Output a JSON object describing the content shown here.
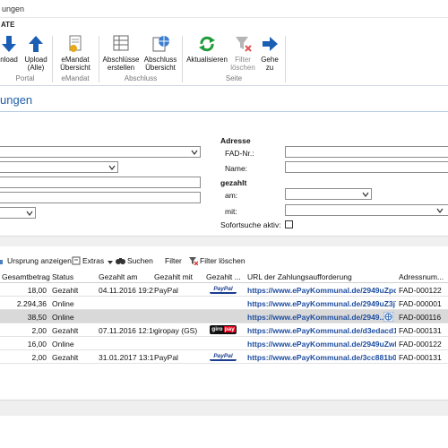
{
  "window": {
    "title": "ungen"
  },
  "ribbon": {
    "tab_label": "ATE",
    "buttons": {
      "download": "nload",
      "upload": "Upload (Alle)",
      "emandat": "eMandat Übersicht",
      "abschluesse_erstellen": "Abschlüsse erstellen",
      "abschluss_uebersicht": "Abschluss Übersicht",
      "aktualisieren": "Aktualisieren",
      "filter_loeschen": "Filter löschen",
      "gehe_zu": "Gehe zu"
    },
    "groups": {
      "portal": "Portal",
      "emandat": "eMandat",
      "abschluss": "Abschluss",
      "seite": "Seite"
    }
  },
  "page": {
    "heading": "ungen"
  },
  "filters": {
    "adresse_label": "Adresse",
    "fad_label": "FAD-Nr.:",
    "name_label": "Name:",
    "gezahlt_label": "gezahlt",
    "am_label": "am:",
    "mit_label": "mit:",
    "sofortsuche_label": "Sofortsuche aktiv:"
  },
  "toolbar": {
    "ursprung": "Ursprung anzeigen",
    "extras": "Extras",
    "suchen": "Suchen",
    "filter": "Filter",
    "filter_loeschen": "Filter löschen"
  },
  "grid": {
    "columns": [
      "Gesamtbetrag",
      "Status",
      "Gezahlt am",
      "Gezahlt mit",
      "Gezahlt ...",
      "URL der Zahlungsaufforderung",
      "Adressnum..."
    ],
    "rows": [
      {
        "betrag": "18,00",
        "status": "Gezahlt",
        "am": "04.11.2016 19:21",
        "mit": "PayPal",
        "logo": "paypal",
        "url": "https://www.ePayKommunal.de/2949uZpd...",
        "adr": "FAD-000122"
      },
      {
        "betrag": "2.294,36",
        "status": "Online",
        "am": "",
        "mit": "",
        "logo": "",
        "url": "https://www.ePayKommunal.de/2949uZ3j7...",
        "adr": "FAD-000001"
      },
      {
        "betrag": "38,50",
        "status": "Online",
        "am": "",
        "mit": "",
        "logo": "",
        "url": "https://www.ePayKommunal.de/2949...",
        "adr": "FAD-000116",
        "selected": true
      },
      {
        "betrag": "2,00",
        "status": "Gezahlt",
        "am": "07.11.2016 12:16",
        "mit": "giropay (GS)",
        "logo": "giropay",
        "url": "https://www.ePayKommunal.de/d3edacd1-...",
        "adr": "FAD-000131"
      },
      {
        "betrag": "16,00",
        "status": "Online",
        "am": "",
        "mit": "",
        "logo": "",
        "url": "https://www.ePayKommunal.de/2949uZwb...",
        "adr": "FAD-000122"
      },
      {
        "betrag": "2,00",
        "status": "Gezahlt",
        "am": "31.01.2017 13:18",
        "mit": "PayPal",
        "logo": "paypal",
        "url": "https://www.ePayKommunal.de/3cc881b0-...",
        "adr": "FAD-000131"
      }
    ],
    "logo_text": {
      "paypal": "PayPal",
      "giro_left": "giro",
      "giro_right": "pay"
    }
  },
  "colors": {
    "accent": "#1f5fa8",
    "link": "#1f4ea0",
    "selected_row": "#d9d9d9"
  }
}
